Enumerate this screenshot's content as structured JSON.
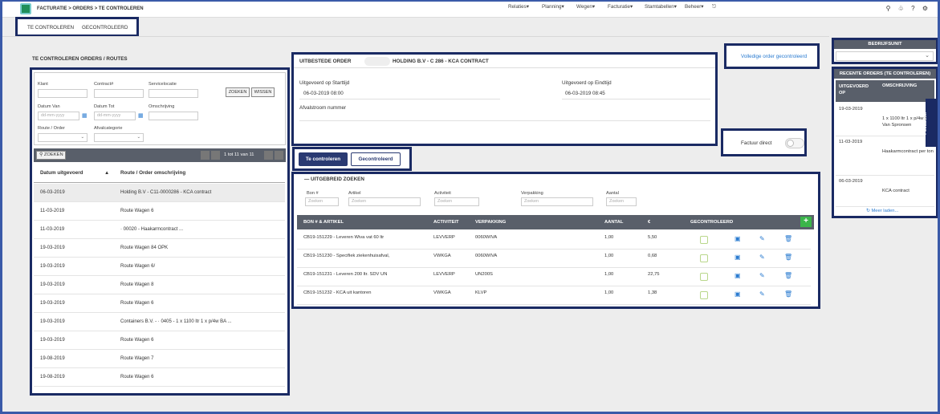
{
  "breadcrumb": "FACTURATIE > ORDERS > TE CONTROLEREN",
  "menu": [
    "Relaties▾",
    "Planning▾",
    "Wegen▾",
    "Facturatie▾",
    "Stamtabellen▾",
    "Beheer▾",
    "⎋"
  ],
  "top_icons": [
    "search-icon",
    "bell-icon",
    "help-icon",
    "settings-icon"
  ],
  "tabs": [
    "TE CONTROLEREN",
    "GECONTROLEERD"
  ],
  "section_title": "TE CONTROLEREN ORDERS / ROUTES",
  "filters": {
    "klant": "Klant",
    "contract": "Contract#",
    "servicelocatie": "Servicelocatie",
    "datum_van": "Datum Van",
    "datum_tot": "Datum Tot",
    "omschrijving": "Omschrijving",
    "route_order": "Route / Order",
    "afvalcategorie": "Afvalcategorie",
    "date_placeholder": "dd-mm-yyyy",
    "zoeken": "ZOEKEN",
    "wissen": "WISSEN"
  },
  "list_toolbar": {
    "search": "ZOEKEN",
    "pager": "1 tot 11 van 11"
  },
  "list_headers": {
    "date": "Datum uitgevoerd",
    "sort": "▲",
    "route": "Route / Order omschrijving"
  },
  "orders": [
    {
      "date": "06-03-2019",
      "desc": "Holding B.V - C11-0000286 - KCA contract"
    },
    {
      "date": "11-03-2019",
      "desc": "Route Wagen 6"
    },
    {
      "date": "11-03-2019",
      "desc": "·                00020 - Haakarmcontract ..."
    },
    {
      "date": "19-03-2019",
      "desc": "Route Wagen 84 OPK"
    },
    {
      "date": "19-03-2019",
      "desc": "Route Wagen 6/"
    },
    {
      "date": "19-03-2019",
      "desc": "Route Wagen 8"
    },
    {
      "date": "19-03-2019",
      "desc": "Route Wagen 6"
    },
    {
      "date": "19-03-2019",
      "desc": "Containers B.V. - ·        0405 - 1 x 1100 ltr 1 x p/4w BA ..."
    },
    {
      "date": "19-03-2019",
      "desc": "Route Wagen 6"
    },
    {
      "date": "19-08-2019",
      "desc": "Route Wagen 7"
    },
    {
      "date": "19-08-2019",
      "desc": "Route Wagen 6"
    }
  ],
  "detail": {
    "title": "UITBESTEDE ORDER",
    "title_rest": "HOLDING B.V - C                  286 - KCA CONTRACT",
    "start_label": "Uitgevoerd op Starttijd",
    "start_value": "06-03-2019 08:00",
    "end_label": "Uitgevoerd op Eindtijd",
    "end_value": "06-03-2019 08:45",
    "afval_label": "Afvalstroom nummer"
  },
  "volledig_link": "Volledige order gecontroleerd",
  "factuur_label": "Factuur direct",
  "buttons": {
    "te_controleren": "Te controleren",
    "gecontroleerd": "Gecontroleerd"
  },
  "uitgebreid": {
    "title": "UITGEBREID ZOEKEN",
    "bon_label": "Bon #",
    "artikel_label": "Artikel",
    "activiteit_label": "Activiteit",
    "verpakking_label": "Verpakking",
    "aantal_label": "Aantal",
    "placeholder": "Zoeken"
  },
  "table_headers": [
    "BON # & ARTIKEL",
    "ACTIVITEIT",
    "VERPAKKING",
    "AANTAL",
    "€",
    "GECONTROLEERD"
  ],
  "lines": [
    {
      "bon": "CB19-151229 - Leveren Wiva vat 60 ltr",
      "act": "LEVVERP",
      "verp": "0060WIVA",
      "aantal": "1,00",
      "eur": "5,50"
    },
    {
      "bon": "CB19-151230 - Specifiek ziekenhuisafval,",
      "act": "VWKGA",
      "verp": "0060WIVA",
      "aantal": "1,00",
      "eur": "0,68"
    },
    {
      "bon": "CB19-151231 - Leveren 200 ltr. SDV UN",
      "act": "LEVVERP",
      "verp": "UN200S",
      "aantal": "1,00",
      "eur": "22,75"
    },
    {
      "bon": "CB19-151232 - KCA uit kantoren",
      "act": "VWKGA",
      "verp": "KLVP",
      "aantal": "1,00",
      "eur": "1,38"
    }
  ],
  "right": {
    "bedrijfsunit": "BEDRIJFSUNIT",
    "recent_title": "RECENTE ORDERS (TE CONTROLEREN)",
    "col1": "UITGEVOERD OP",
    "col2": "OMSCHRIJVING",
    "recent": [
      {
        "date": "19-03-2019",
        "desc": "1 x 1100 ltr 1 x p/4w BA Van Spronsen"
      },
      {
        "date": "11-03-2019",
        "desc": "Haakarmcontract per ton"
      },
      {
        "date": "06-03-2019",
        "desc": "KCA contract"
      }
    ],
    "meer": "Meer laden..."
  },
  "feedback": "Feedback"
}
